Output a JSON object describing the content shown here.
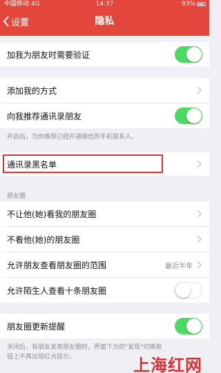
{
  "status_bar": {
    "carrier": "中国移动 4G",
    "time": "14:37",
    "battery": "93%"
  },
  "nav": {
    "back_label": "设置",
    "title": "隐私"
  },
  "rows": {
    "verify": {
      "label": "加我为朋友时需要验证",
      "toggle": "on"
    },
    "add_me_ways": {
      "label": "添加我的方式"
    },
    "recommend_contacts": {
      "label": "向我推荐通讯录朋友",
      "toggle": "on"
    },
    "recommend_note": "开启后，为你推荐已经开通微信的手机联系人。",
    "blacklist": {
      "label": "通讯录黑名单"
    },
    "moments_header": "朋友圈",
    "hide_my_moments": {
      "label": "不让他(她)看我的朋友圈"
    },
    "hide_their_moments": {
      "label": "不看他(她)的朋友圈"
    },
    "moments_range": {
      "label": "允许朋友查看朋友圈的范围",
      "value": "最近半年"
    },
    "stranger_ten": {
      "label": "允许陌生人查看十条朋友圈",
      "toggle": "off"
    },
    "moments_update": {
      "label": "朋友圈更新提醒",
      "toggle": "on"
    },
    "update_note": "关闭后，有朋友发表朋友圈时，界面下方的\"发现\"切换按钮上不再出现红点提示。"
  },
  "watermark": "上海红网",
  "colors": {
    "nav_bg": "#e3463a",
    "toggle_on": "#4cd964",
    "highlight": "#d93131"
  }
}
